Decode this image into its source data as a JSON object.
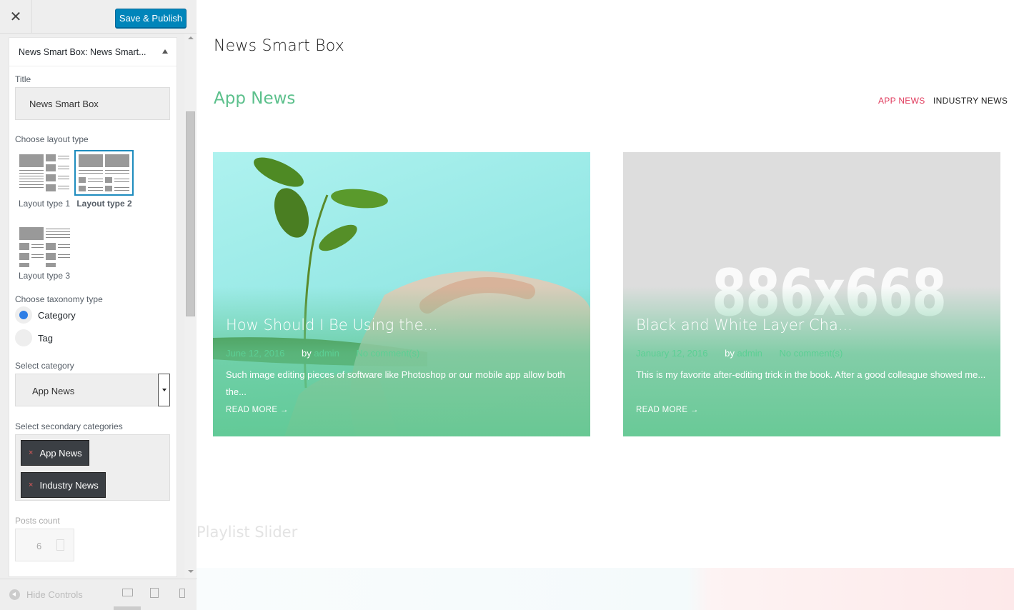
{
  "topbar": {
    "close_glyph": "✕",
    "publish_label": "Save & Publish"
  },
  "panel": {
    "header_prefix": "News Smart Box:",
    "header_suffix": "News Smart...",
    "title_label": "Title",
    "title_value": "News Smart Box",
    "layout_label": "Choose layout type",
    "layouts": [
      "Layout type 1",
      "Layout type 2",
      "Layout type 3"
    ],
    "selected_layout": "Layout type 2",
    "taxonomy_label": "Choose taxonomy type",
    "taxonomy_options": [
      "Category",
      "Tag"
    ],
    "taxonomy_selected": "Category",
    "category_label": "Select category",
    "category_value": "App News",
    "secondary_label": "Select secondary categories",
    "secondary_chips": [
      "App News",
      "Industry News"
    ],
    "chip_remove_glyph": "×",
    "posts_count_label": "Posts count",
    "posts_count_value": "6"
  },
  "footer": {
    "hide_controls": "Hide Controls"
  },
  "preview": {
    "widget_title": "News Smart Box",
    "section_title": "App News",
    "tabs": [
      {
        "label": "APP NEWS",
        "color": "#e03a5c"
      },
      {
        "label": "INDUSTRY NEWS",
        "color": "#222222"
      }
    ],
    "cards": [
      {
        "title": "How Should I Be Using the...",
        "date": "June 12, 2016",
        "by": "by",
        "author": "admin",
        "comments": "No comment(s)",
        "excerpt": "Such image editing pieces of software like Photoshop or our mobile app allow both the...",
        "read_more": "READ MORE"
      },
      {
        "title": "Black and White Layer Cha...",
        "date": "January 12, 2016",
        "by": "by",
        "author": "admin",
        "comments": "No comment(s)",
        "excerpt": "This is my favorite after-editing trick in the book. After a good colleague showed me...",
        "read_more": "READ MORE",
        "placeholder_text": "886x668"
      }
    ],
    "next_section_title": "Playlist Slider"
  },
  "colors": {
    "accent_blue": "#0085ba",
    "green": "#5cc08c",
    "tab_active": "#e03a5c"
  }
}
